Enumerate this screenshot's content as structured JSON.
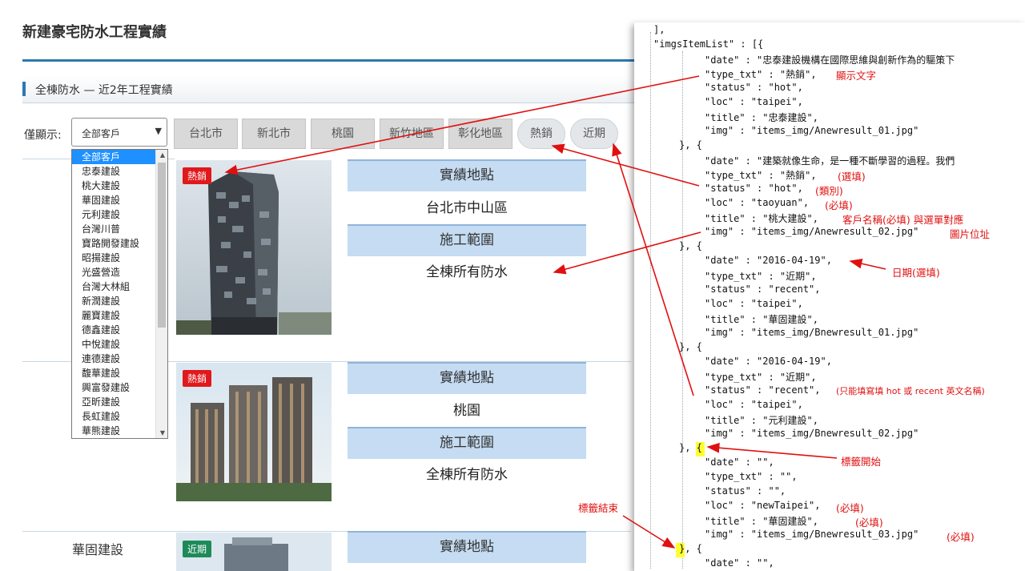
{
  "page": {
    "title": "新建豪宅防水工程實績",
    "section": "全棟防水 — 近2年工程實績"
  },
  "filter": {
    "label": "僅顯示:",
    "selected": "全部客戶",
    "options": [
      "全部客戶",
      "忠泰建設",
      "桃大建設",
      "華固建設",
      "元利建設",
      "台灣川普",
      "寶路開發建設",
      "昭揚建設",
      "光盛營造",
      "台灣大林組",
      "新潤建設",
      "麗寶建設",
      "德鑫建設",
      "中悅建設",
      "連德建設",
      "馥華建設",
      "興富發建設",
      "亞昕建設",
      "長虹建設",
      "華熊建設"
    ],
    "region_buttons": [
      "台北市",
      "新北市",
      "桃園",
      "新竹地區",
      "彰化地區"
    ],
    "pill_buttons": [
      "熱銷",
      "近期"
    ]
  },
  "cards": [
    {
      "tag": "熱銷",
      "tag_type": "hot",
      "loc_label": "實績地點",
      "loc": "台北市中山區",
      "scope_label": "施工範圍",
      "scope": "全棟所有防水"
    },
    {
      "tag": "熱銷",
      "tag_type": "hot",
      "loc_label": "實績地點",
      "loc": "桃園",
      "scope_label": "施工範圍",
      "scope": "全棟所有防水"
    },
    {
      "tag": "近期",
      "tag_type": "recent",
      "company": "華固建設",
      "loc_label": "實績地點"
    }
  ],
  "code": {
    "lines": [
      "],",
      "\"imgsItemList\" : [{",
      "\"date\" : \"忠泰建設機構在國際思維與創新作為的驅策下",
      "\"type_txt\" : \"熱銷\",",
      "\"status\" : \"hot\",",
      "\"loc\" : \"taipei\",",
      "\"title\" : \"忠泰建設\",",
      "\"img\" : \"items_img/Anewresult_01.jpg\"",
      "}, {",
      "\"date\" : \"建築就像生命，是一種不斷學習的過程。我們",
      "\"type_txt\" : \"熱銷\",",
      "\"status\" : \"hot\",",
      "\"loc\" : \"taoyuan\",",
      "\"title\" : \"桃大建設\",",
      "\"img\" : \"items_img/Anewresult_02.jpg\"",
      "}, {",
      "\"date\" : \"2016-04-19\",",
      "\"type_txt\" : \"近期\",",
      "\"status\" : \"recent\",",
      "\"loc\" : \"taipei\",",
      "\"title\" : \"華固建設\",",
      "\"img\" : \"items_img/Bnewresult_01.jpg\"",
      "}, {",
      "\"date\" : \"2016-04-19\",",
      "\"type_txt\" : \"近期\",",
      "\"status\" : \"recent\",",
      "\"loc\" : \"taipei\",",
      "\"title\" : \"元利建設\",",
      "\"img\" : \"items_img/Bnewresult_02.jpg\"",
      "}, {",
      "\"date\" : \"\",",
      "\"type_txt\" : \"\",",
      "\"status\" : \"\",",
      "\"loc\" : \"newTaipei\",",
      "\"title\" : \"華固建設\",",
      "\"img\" : \"items_img/Bnewresult_03.jpg\"",
      "}, {",
      "\"date\" : \"\","
    ],
    "notes": {
      "display_text": "顯示文字",
      "optional1": "(選填)",
      "category": "(類別)",
      "required1": "(必填)",
      "client_name": "客戶名稱(必填) 與選單對應",
      "image_url": "圖片位址",
      "date_note": "日期(選填)",
      "status_note": "(只能填寫填 hot 或 recent 英文名稱)",
      "tag_start": "標籤開始",
      "required2": "(必填)",
      "required3": "(必填)",
      "required4": "(必填)",
      "tag_end": "標籤結束"
    }
  },
  "colors": {
    "accent": "#2e78b0",
    "hot": "#e0191c",
    "recent": "#1e8a5a",
    "annotation": "#e01010",
    "highlight": "#ffff30"
  }
}
